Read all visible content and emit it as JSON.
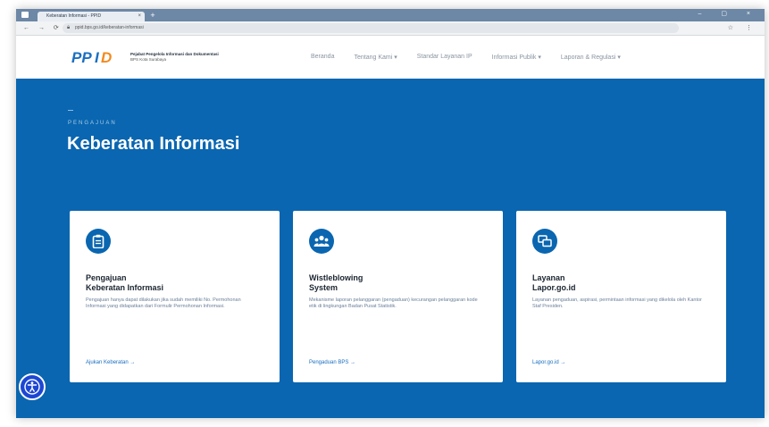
{
  "browser": {
    "tab_title": "Keberatan Informasi - PPID",
    "tab_close": "×",
    "new_tab": "+",
    "nav_buttons": "← → ⟳",
    "url": "ppid.bps.go.id/keberatan-informasi",
    "window_controls": "– ▢ ×",
    "toolbar_icons": "☆ ⋮"
  },
  "header": {
    "logo_text": "PPID",
    "logo_line1": "Pejabat Pengelola Informasi dan Dokumentasi",
    "logo_line2": "BPS Kota Surabaya",
    "nav": [
      {
        "label": "Beranda"
      },
      {
        "label": "Tentang Kami ▾"
      },
      {
        "label": "Standar Layanan IP"
      },
      {
        "label": "Informasi Publik ▾"
      },
      {
        "label": "Laporan & Regulasi ▾"
      }
    ]
  },
  "hero": {
    "kicker": "PENGAJUAN",
    "title": "Keberatan Informasi"
  },
  "cards": [
    {
      "icon": "clipboard-icon",
      "title_l1": "Pengajuan",
      "title_l2": "Keberatan Informasi",
      "desc": "Pengajuan hanya dapat dilakukan jika sudah memiliki No. Permohonan Informasi yang didapatkan dari Formulir Permohonan Informasi.",
      "link": "Ajukan Keberatan →"
    },
    {
      "icon": "people-icon",
      "title_l1": "Wistleblowing",
      "title_l2": "System",
      "desc": "Mekanisme laporan pelanggaran (pengaduan) kecurangan pelanggaran kode etik di lingkungan Badan Pusat Statistik.",
      "link": "Pengaduan BPS →"
    },
    {
      "icon": "chat-icon",
      "title_l1": "Layanan",
      "title_l2": "Lapor.go.id",
      "desc": "Layanan pengaduan, aspirasi, permintaan informasi yang dikelola oleh Kantor Staf Presiden.",
      "link": "Lapor.go.id →"
    }
  ],
  "colors": {
    "hero_bg": "#0a66b0",
    "accent": "#1a6fc0",
    "a11y": "#1c46d4"
  }
}
